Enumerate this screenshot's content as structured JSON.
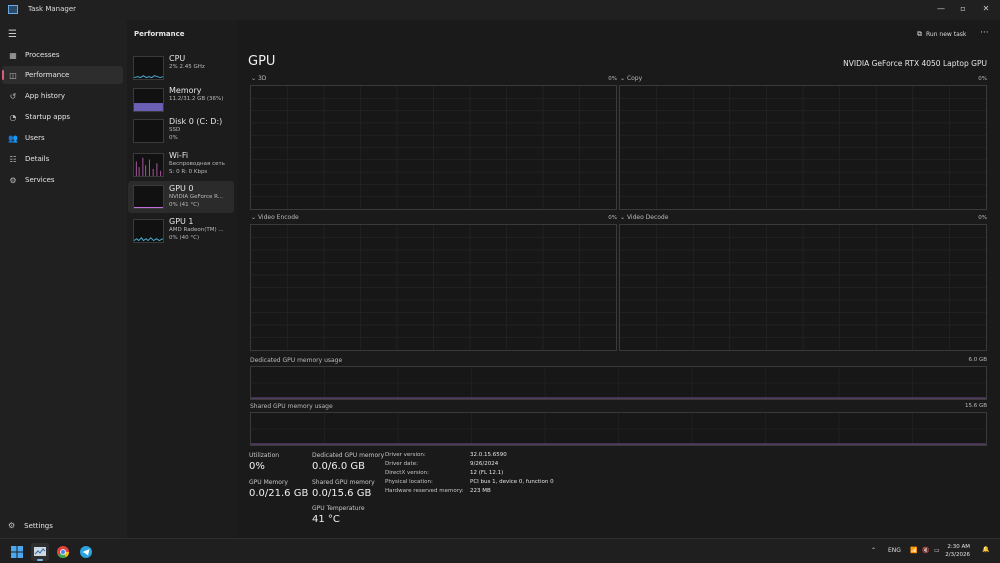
{
  "window": {
    "title": "Task Manager"
  },
  "nav": {
    "items": [
      {
        "label": "Processes",
        "icon": "processes-icon"
      },
      {
        "label": "Performance",
        "icon": "performance-icon"
      },
      {
        "label": "App history",
        "icon": "history-icon"
      },
      {
        "label": "Startup apps",
        "icon": "startup-icon"
      },
      {
        "label": "Users",
        "icon": "users-icon"
      },
      {
        "label": "Details",
        "icon": "details-icon"
      },
      {
        "label": "Services",
        "icon": "services-icon"
      }
    ],
    "settings": "Settings"
  },
  "perf": {
    "header": "Performance",
    "items": [
      {
        "name": "CPU",
        "line1": "2%  2.45 GHz",
        "line2": ""
      },
      {
        "name": "Memory",
        "line1": "11.2/31.2 GB (36%)",
        "line2": ""
      },
      {
        "name": "Disk 0 (C: D:)",
        "line1": "SSD",
        "line2": "0%"
      },
      {
        "name": "Wi-Fi",
        "line1": "Беспроводная сеть",
        "line2": "S: 0  R: 0 Kbps"
      },
      {
        "name": "GPU 0",
        "line1": "NVIDIA GeForce R...",
        "line2": "0% (41 °C)"
      },
      {
        "name": "GPU 1",
        "line1": "AMD Radeon(TM) ...",
        "line2": "0% (40 °C)"
      }
    ]
  },
  "toolbar": {
    "run_new_task": "Run new task",
    "more": "···"
  },
  "gpu": {
    "title": "GPU",
    "model": "NVIDIA GeForce RTX 4050 Laptop GPU",
    "graphs": [
      {
        "label": "3D",
        "pct": "0%"
      },
      {
        "label": "Copy",
        "pct": "0%"
      },
      {
        "label": "Video Encode",
        "pct": "0%"
      },
      {
        "label": "Video Decode",
        "pct": "0%"
      }
    ],
    "dedicated": {
      "label": "Dedicated GPU memory usage",
      "max": "6.0 GB"
    },
    "shared": {
      "label": "Shared GPU memory usage",
      "max": "15.6 GB"
    },
    "stats": {
      "utilization_label": "Utilization",
      "utilization": "0%",
      "gpu_memory_label": "GPU Memory",
      "gpu_memory": "0.0/21.6 GB",
      "dedicated_label": "Dedicated GPU memory",
      "dedicated": "0.0/6.0 GB",
      "shared_label": "Shared GPU memory",
      "shared": "0.0/15.6 GB",
      "temp_label": "GPU Temperature",
      "temp": "41 °C"
    },
    "info": [
      {
        "key": "Driver version:",
        "value": "32.0.15.6590"
      },
      {
        "key": "Driver date:",
        "value": "9/26/2024"
      },
      {
        "key": "DirectX version:",
        "value": "12 (FL 12.1)"
      },
      {
        "key": "Physical location:",
        "value": "PCI bus 1, device 0, function 0"
      },
      {
        "key": "Hardware reserved memory:",
        "value": "223 MB"
      }
    ]
  },
  "taskbar": {
    "lang": "ENG",
    "time": "2:30 AM",
    "date": "2/3/2026"
  },
  "colors": {
    "accent": "#e05a7a",
    "cpu": "#4ab0d6",
    "memory": "#8b7fd4",
    "gpu": "#c070d8"
  }
}
